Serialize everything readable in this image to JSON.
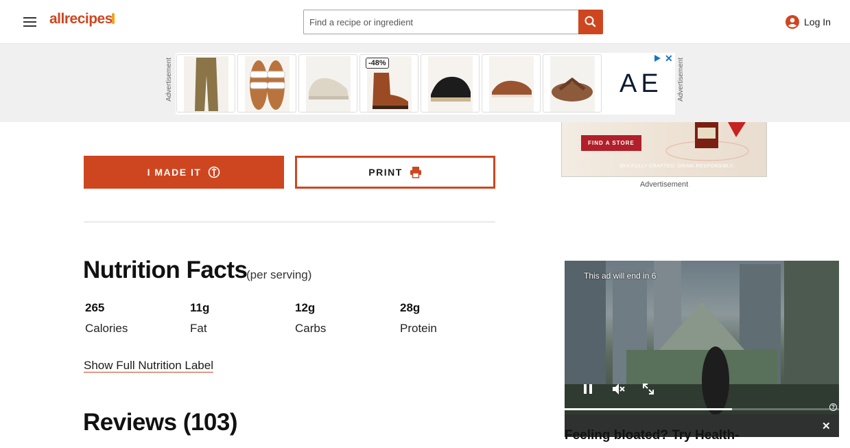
{
  "header": {
    "logo_text": "allrecipes",
    "search_placeholder": "Find a recipe or ingredient",
    "login_label": "Log In"
  },
  "top_ad": {
    "label": "Advertisement",
    "badge": "-48%",
    "brand": "AE",
    "products": [
      "cargo-pants",
      "white-sandals",
      "sneakers",
      "chelsea-boots",
      "black-sandals",
      "boat-shoes",
      "flip-flops"
    ]
  },
  "side_ad": {
    "cta": "FIND A STORE",
    "tagline": "SKILFULLY CRAFTED. DRINK RESPONSIBLY.",
    "label": "Advertisement"
  },
  "actions": {
    "made_it": "I MADE IT",
    "print": "PRINT"
  },
  "nutrition": {
    "title": "Nutrition Facts",
    "subtitle": "(per serving)",
    "facts": [
      {
        "value": "265",
        "label": "Calories"
      },
      {
        "value": "11g",
        "label": "Fat"
      },
      {
        "value": "12g",
        "label": "Carbs"
      },
      {
        "value": "28g",
        "label": "Protein"
      }
    ],
    "show_full": "Show Full Nutrition Label"
  },
  "reviews": {
    "title": "Reviews (103)"
  },
  "video_ad": {
    "timer_text": "This ad will end in 6",
    "progress": 0.61,
    "headline": "Feeling bloated? Try Health-"
  },
  "colors": {
    "brand": "#ce4620",
    "logo_accent": "#f2a31b"
  }
}
